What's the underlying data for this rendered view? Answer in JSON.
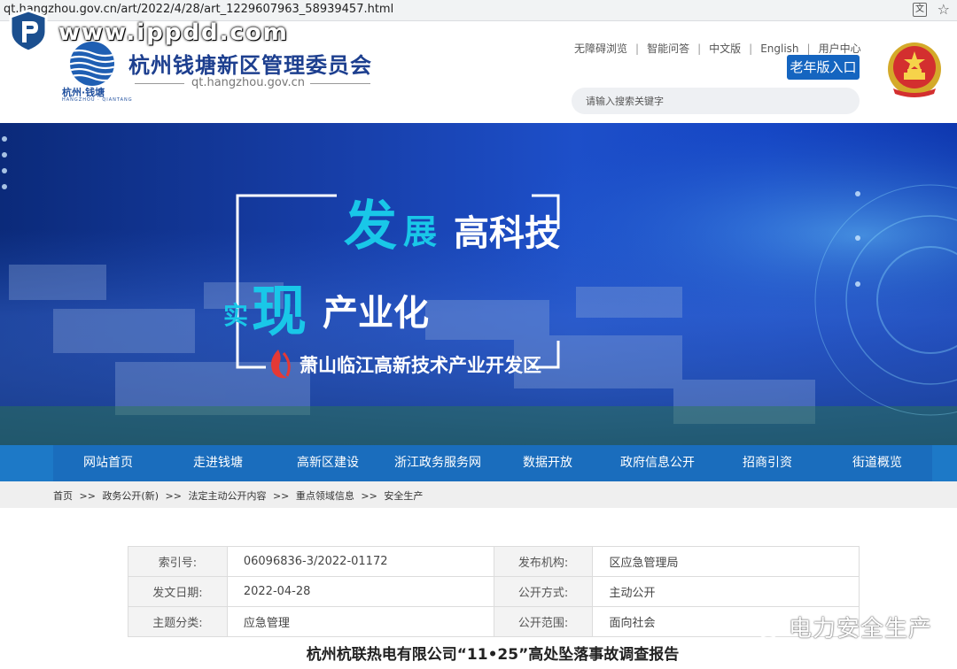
{
  "browser": {
    "url": "qt.hangzhou.gov.cn/art/2022/4/28/art_1229607963_58939457.html",
    "translate_icon": "translate-icon",
    "bookmark_icon": "star-icon"
  },
  "watermark_top": {
    "text": "www.ippdd.com",
    "icon": "shield-p-logo"
  },
  "header": {
    "logo_city": "杭州·钱塘",
    "logo_city_en": "HANGZHOU · QIANTANG",
    "site_name": "杭州钱塘新区管理委员会",
    "domain": "qt.hangzhou.gov.cn",
    "links": [
      "无障碍浏览",
      "智能问答",
      "中文版",
      "English",
      "用户中心"
    ],
    "elder_button": "老年版入口",
    "search_placeholder": "请输入搜索关键字",
    "emblem_icon": "national-emblem-icon"
  },
  "banner": {
    "line1_big": "发",
    "line1_mid": "展",
    "line1_rest": "高科技",
    "line2_small": "实",
    "line2_big": "现",
    "line2_rest": "产业化",
    "zone_name": "萧山临江高新技术产业开发区"
  },
  "nav": [
    "网站首页",
    "走进钱塘",
    "高新区建设",
    "浙江政务服务网",
    "数据开放",
    "政府信息公开",
    "招商引资",
    "街道概览"
  ],
  "breadcrumb": [
    "首页",
    "政务公开(新)",
    "法定主动公开内容",
    "重点领域信息",
    "安全生产"
  ],
  "breadcrumb_sep": ">>",
  "meta": [
    [
      {
        "k": "索引号:",
        "v": "06096836-3/2022-01172"
      },
      {
        "k": "发布机构:",
        "v": "区应急管理局"
      }
    ],
    [
      {
        "k": "发文日期:",
        "v": "2022-04-28"
      },
      {
        "k": "公开方式:",
        "v": "主动公开"
      }
    ],
    [
      {
        "k": "主题分类:",
        "v": "应急管理"
      },
      {
        "k": "公开范围:",
        "v": "面向社会"
      }
    ]
  ],
  "article_title": "杭州杭联热电有限公司“11•25”高处坠落事故调查报告",
  "watermark_bottom": {
    "text": "电力安全生产",
    "icon": "wechat-icon"
  }
}
